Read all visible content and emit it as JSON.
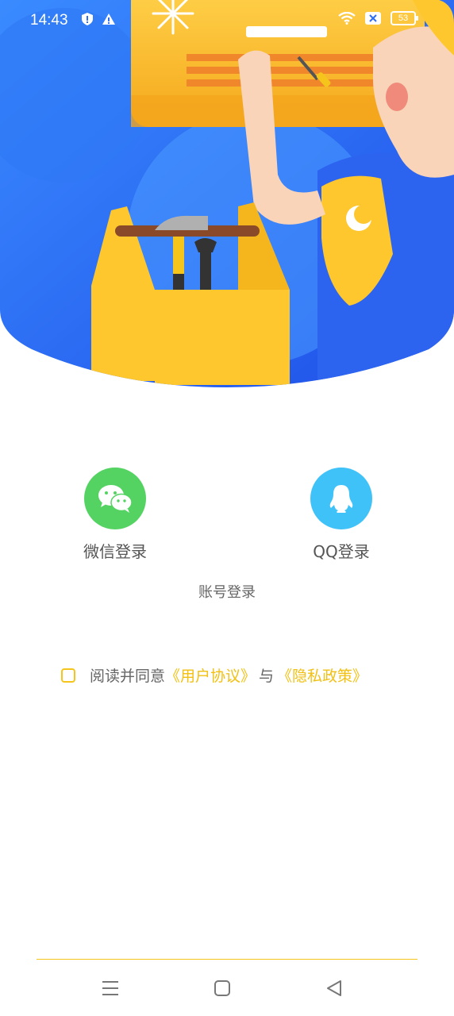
{
  "status_bar": {
    "time": "14:43",
    "battery": "53",
    "left_icons": [
      "shield-icon",
      "warning-icon"
    ],
    "right_icons": [
      "wifi-icon",
      "sim-x-icon",
      "battery-icon"
    ]
  },
  "login": {
    "wechat_label": "微信登录",
    "qq_label": "QQ登录",
    "account_label": "账号登录"
  },
  "agreement": {
    "prefix": "阅读并同意",
    "user_agreement": "《用户协议》",
    "conjunction": "与",
    "privacy_policy": "《隐私政策》"
  },
  "colors": {
    "brand_yellow": "#f5c51c",
    "hero_blue": "#2f6df2",
    "wechat_green": "#54d363",
    "qq_blue": "#3fc2f7"
  },
  "nav": {
    "icons": [
      "menu-icon",
      "home-icon",
      "back-icon"
    ]
  }
}
